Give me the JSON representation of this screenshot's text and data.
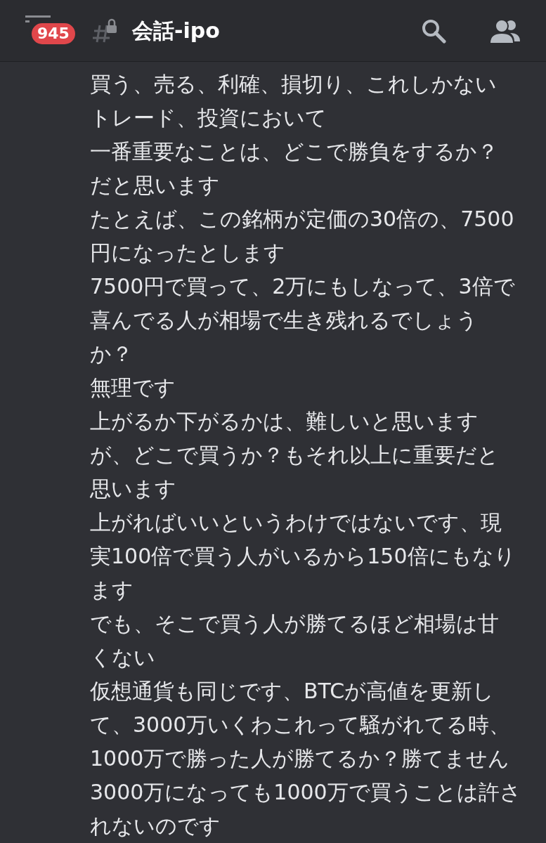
{
  "header": {
    "unread_badge": "945",
    "channel_name": "会話-ipo"
  },
  "message_lines": [
    "買う、売る、利確、損切り、これしかない",
    "トレード、投資において",
    "一番重要なことは、どこで勝負をするか？",
    "だと思います",
    "たとえば、この銘柄が定価の30倍の、7500",
    "円になったとします",
    "7500円で買って、2万にもしなって、3倍で",
    "喜んでる人が相場で生き残れるでしょう",
    "か？",
    "無理です",
    "上がるか下がるかは、難しいと思います",
    "が、どこで買うか？もそれ以上に重要だと",
    "思います",
    "上がればいいというわけではないです、現",
    "実100倍で買う人がいるから150倍にもなり",
    "ます",
    "でも、そこで買う人が勝てるほど相場は甘",
    "くない",
    "仮想通貨も同じです、BTCが高値を更新し",
    "て、3000万いくわこれって騒がれてる時、",
    "1000万で勝った人が勝てるか？勝てません",
    "3000万になっても1000万で買うことは許さ",
    "れないのです"
  ]
}
